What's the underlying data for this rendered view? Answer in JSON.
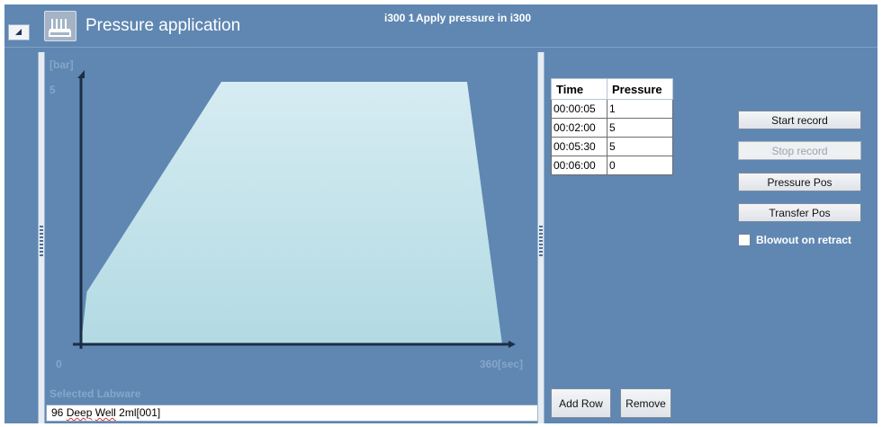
{
  "header": {
    "title": "Pressure application",
    "instrument": "i300 1",
    "step_description": "Apply pressure in i300",
    "collapse_icon": "triangle-collapse-icon",
    "module_icon": "pressure-module-icon"
  },
  "chart_data": {
    "type": "area",
    "ylabel": "[bar]",
    "xlabel": "[sec]",
    "ymax_label": "5",
    "xmin_label": "0",
    "xmax_label": "360[sec]",
    "xlim": [
      0,
      360
    ],
    "ylim": [
      0,
      5
    ],
    "x": [
      0,
      5,
      120,
      330,
      360,
      0
    ],
    "y": [
      0,
      1,
      5,
      5,
      0,
      0
    ],
    "fill_colors": [
      "#d6ecf2",
      "#b2dae3"
    ],
    "grid": false
  },
  "labware": {
    "label": "Selected Labware",
    "value_prefix": "96 ",
    "value_word1": "Deep",
    "value_space": " ",
    "value_word2": "Well",
    "value_suffix": " 2ml[001]"
  },
  "table": {
    "headers": [
      "Time",
      "Pressure"
    ],
    "rows": [
      {
        "time": "00:00:05",
        "pressure": "1"
      },
      {
        "time": "00:02:00",
        "pressure": "5"
      },
      {
        "time": "00:05:30",
        "pressure": "5"
      },
      {
        "time": "00:06:00",
        "pressure": "0"
      }
    ]
  },
  "buttons": {
    "start_record": "Start record",
    "stop_record": "Stop record",
    "pressure_pos": "Pressure Pos",
    "transfer_pos": "Transfer Pos",
    "add_row": "Add Row",
    "remove": "Remove"
  },
  "options": {
    "blowout_label": "Blowout on retract",
    "blowout_checked": false
  },
  "colors": {
    "panel": "#5f87b2",
    "axis_text": "#85a6c9"
  }
}
